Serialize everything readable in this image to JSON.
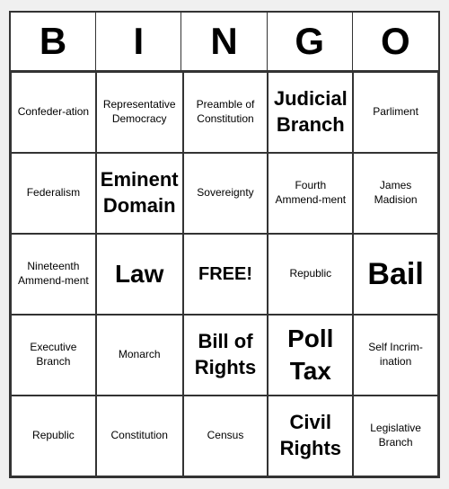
{
  "header": {
    "letters": [
      "B",
      "I",
      "N",
      "G",
      "O"
    ]
  },
  "cells": [
    {
      "text": "Confeder-ation",
      "size": "normal"
    },
    {
      "text": "Representative Democracy",
      "size": "normal"
    },
    {
      "text": "Preamble of Constitution",
      "size": "normal"
    },
    {
      "text": "Judicial Branch",
      "size": "large"
    },
    {
      "text": "Parliment",
      "size": "normal"
    },
    {
      "text": "Federalism",
      "size": "normal"
    },
    {
      "text": "Eminent Domain",
      "size": "large"
    },
    {
      "text": "Sovereignty",
      "size": "normal"
    },
    {
      "text": "Fourth Ammend-ment",
      "size": "normal"
    },
    {
      "text": "James Madision",
      "size": "normal"
    },
    {
      "text": "Nineteenth Ammend-ment",
      "size": "normal"
    },
    {
      "text": "Law",
      "size": "xlarge"
    },
    {
      "text": "FREE!",
      "size": "free"
    },
    {
      "text": "Republic",
      "size": "normal"
    },
    {
      "text": "Bail",
      "size": "xxlarge"
    },
    {
      "text": "Executive Branch",
      "size": "normal"
    },
    {
      "text": "Monarch",
      "size": "normal"
    },
    {
      "text": "Bill of Rights",
      "size": "large"
    },
    {
      "text": "Poll Tax",
      "size": "xlarge"
    },
    {
      "text": "Self Incrim-ination",
      "size": "normal"
    },
    {
      "text": "Republic",
      "size": "normal"
    },
    {
      "text": "Constitution",
      "size": "normal"
    },
    {
      "text": "Census",
      "size": "normal"
    },
    {
      "text": "Civil Rights",
      "size": "large"
    },
    {
      "text": "Legislative Branch",
      "size": "normal"
    }
  ]
}
